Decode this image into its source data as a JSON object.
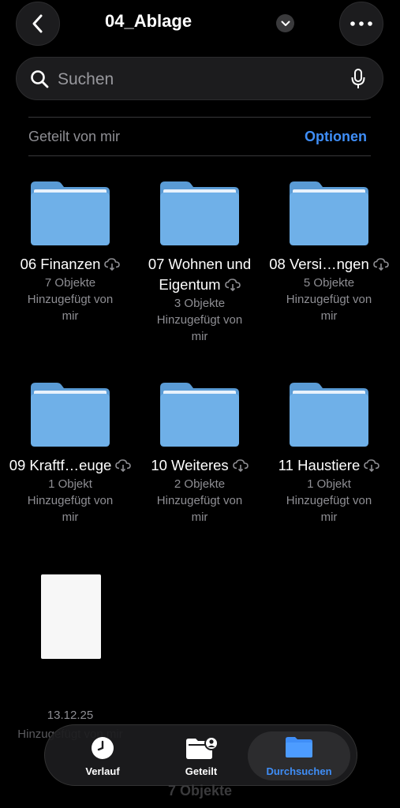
{
  "header": {
    "title": "04_Ablage"
  },
  "search": {
    "placeholder": "Suchen"
  },
  "section": {
    "label": "Geteilt von mir",
    "options": "Optionen"
  },
  "folders": [
    {
      "name": "06 Finanzen",
      "count": "7 Objekte",
      "sub": "Hinzugefügt von mir"
    },
    {
      "name": "07 Wohnen und Eigentum",
      "count": "3 Objekte",
      "sub": "Hinzugefügt von mir"
    },
    {
      "name": "08 Versi…ngen",
      "count": "5 Objekte",
      "sub": "Hinzugefügt von mir"
    },
    {
      "name": "09 Kraftf…euge",
      "count": "1 Objekt",
      "sub": "Hinzugefügt von mir"
    },
    {
      "name": "10 Weiteres",
      "count": "2 Objekte",
      "sub": "Hinzugefügt von mir"
    },
    {
      "name": "11 Haustiere",
      "count": "1 Objekt",
      "sub": "Hinzugefügt von mir"
    }
  ],
  "document": {
    "date": "13.12.25",
    "sub": "Hinzugefügt von mir"
  },
  "tabs": [
    {
      "label": "Verlauf",
      "icon": "clock-icon"
    },
    {
      "label": "Geteilt",
      "icon": "shared-folder-icon"
    },
    {
      "label": "Durchsuchen",
      "icon": "folder-icon"
    }
  ],
  "footer": {
    "count": "7 Objekte"
  },
  "colors": {
    "accent": "#3f8ef7",
    "folder": "#6fb0e8"
  }
}
